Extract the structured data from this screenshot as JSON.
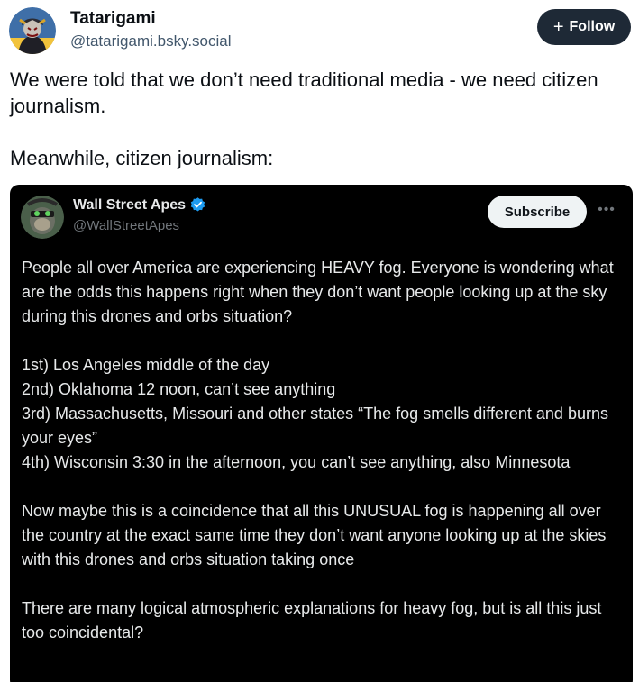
{
  "post": {
    "author_name": "Tatarigami",
    "author_handle": "@tatarigami.bsky.social",
    "follow_label": "Follow",
    "text_paragraphs": [
      "We were told that we don’t need traditional media - we need citizen journalism.",
      "Meanwhile, citizen journalism:"
    ]
  },
  "embedded_image": {
    "author_name": "Wall Street Apes",
    "author_handle": "@WallStreetApes",
    "subscribe_label": "Subscribe",
    "paragraph_1": "People all over America are experiencing HEAVY fog. Everyone is wondering what are the odds this happens right when they don’t want people looking up at the sky during this drones and orbs situation?",
    "list": [
      "1st) Los Angeles middle of the day",
      "2nd) Oklahoma 12 noon, can’t see anything",
      "3rd) Massachusetts, Missouri and other states “The fog smells different and burns your eyes”",
      "4th) Wisconsin 3:30 in the afternoon, you can’t see anything, also Minnesota"
    ],
    "paragraph_3": "Now maybe this is a coincidence that all this UNUSUAL fog is happening all over the country at the exact same time they don’t want anyone looking up at the skies with this drones and orbs situation taking once",
    "paragraph_4": "There are many logical atmospheric explanations for heavy fog, but is all this just too coincidental?"
  },
  "colors": {
    "follow_bg": "#1e2936",
    "handle_gray": "#42576c",
    "embed_bg": "#000000",
    "verified_blue": "#1d9bf0"
  },
  "icons": {
    "avatar": "samurai-avatar",
    "follow": "plus-icon",
    "embed_avatar": "ape-avatar",
    "verified": "verified-badge-icon",
    "more": "more-dots-icon"
  }
}
